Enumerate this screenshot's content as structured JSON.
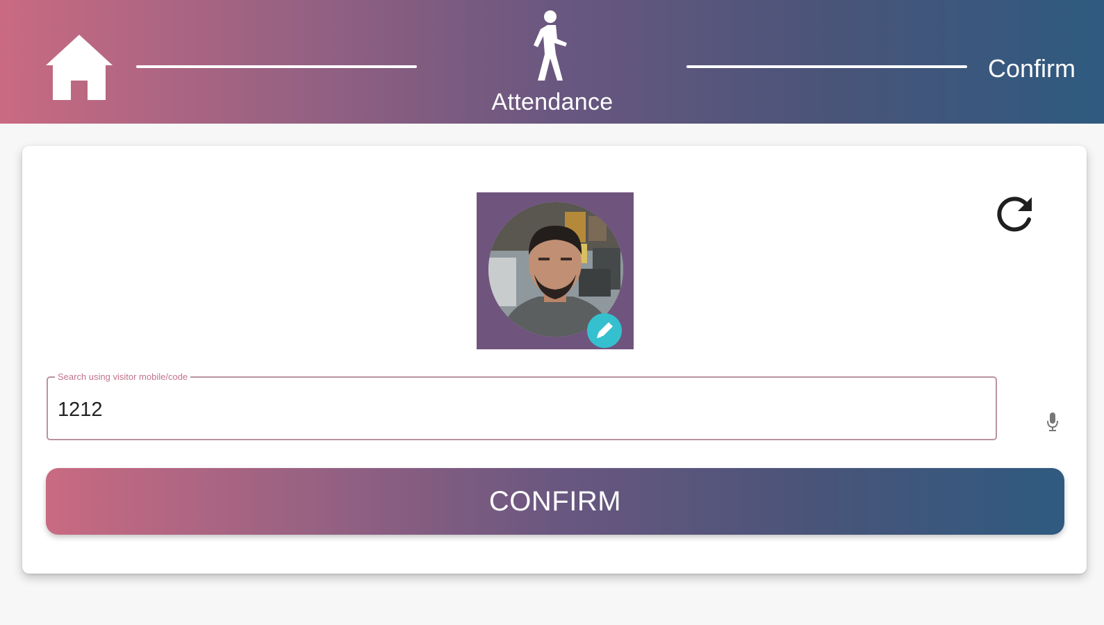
{
  "colors": {
    "gradient_start": "#c96a82",
    "gradient_end": "#2f5a80",
    "accent_teal": "#35c0cf",
    "photo_frame": "#6f557e"
  },
  "header": {
    "home_icon": "home-icon",
    "step_icon": "walking-person-icon",
    "step_label": "Attendance",
    "confirm_label": "Confirm"
  },
  "profile": {
    "photo": "visitor-photo",
    "edit_icon": "pencil-icon"
  },
  "refresh_icon": "refresh-icon",
  "search": {
    "label": "Search using visitor mobile/code",
    "value": "1212",
    "mic_icon": "microphone-icon"
  },
  "confirm_button": {
    "label": "CONFIRM"
  }
}
